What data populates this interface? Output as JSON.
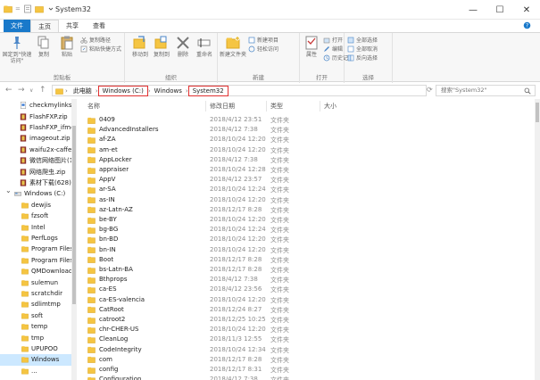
{
  "window": {
    "title": "System32",
    "qa_separator": "=",
    "controls": [
      "—",
      "☐",
      "✕"
    ]
  },
  "tabs": [
    {
      "label": "文件",
      "kind": "file"
    },
    {
      "label": "主页",
      "kind": "active"
    },
    {
      "label": "共享",
      "kind": "normal"
    },
    {
      "label": "查看",
      "kind": "normal"
    }
  ],
  "ribbon": {
    "clipboard": {
      "name": "剪贴板",
      "pin_label": "固定到\"快速访问\"",
      "copy_label": "复制",
      "paste_label": "粘贴",
      "cut_label": "剪切",
      "copy_path_label": "复制路径",
      "paste_shortcut_label": "粘贴快捷方式"
    },
    "organize": {
      "name": "组织",
      "move_label": "移动到",
      "copy_to_label": "复制到",
      "delete_label": "删除",
      "rename_label": "重命名"
    },
    "new": {
      "name": "新建",
      "folder_label": "新建文件夹",
      "item_label": "新建项目",
      "easy_access_label": "轻松访问"
    },
    "open": {
      "name": "打开",
      "props_label": "属性",
      "open_label": "打开",
      "edit_label": "编辑",
      "history_label": "历史记录"
    },
    "select": {
      "name": "选择",
      "all_label": "全部选择",
      "none_label": "全部取消",
      "invert_label": "反向选择"
    }
  },
  "address": {
    "crumbs": [
      "此电脑",
      "Windows (C:)",
      "Windows",
      "System32"
    ],
    "search_placeholder": "搜索\"System32\""
  },
  "columns": {
    "name": "名称",
    "date": "修改日期",
    "type": "类型",
    "size": "大小"
  },
  "nav_items": [
    {
      "label": "checkmylinks",
      "icon": "file"
    },
    {
      "label": "FlashFXP.zip",
      "icon": "zip"
    },
    {
      "label": "FlashFXP_ifmc",
      "icon": "zip"
    },
    {
      "label": "imageout.zip",
      "icon": "zip"
    },
    {
      "label": "waifu2x-caffe",
      "icon": "zip"
    },
    {
      "label": "微信网络图片(1).",
      "icon": "zip"
    },
    {
      "label": "网络爬虫.zip",
      "icon": "zip"
    },
    {
      "label": "素材下载(628)",
      "icon": "zip"
    },
    {
      "label": "Windows (C:)",
      "icon": "drive"
    },
    {
      "label": "dewjis",
      "icon": "folder"
    },
    {
      "label": "fzsoft",
      "icon": "folder"
    },
    {
      "label": "Intel",
      "icon": "folder"
    },
    {
      "label": "PerfLogs",
      "icon": "folder"
    },
    {
      "label": "Program Files",
      "icon": "folder"
    },
    {
      "label": "Program Files",
      "icon": "folder"
    },
    {
      "label": "QMDownload",
      "icon": "folder"
    },
    {
      "label": "sulemun",
      "icon": "folder"
    },
    {
      "label": "scratchdir",
      "icon": "folder"
    },
    {
      "label": "sdlimtmp",
      "icon": "folder"
    },
    {
      "label": "soft",
      "icon": "folder"
    },
    {
      "label": "temp",
      "icon": "folder"
    },
    {
      "label": "tmp",
      "icon": "folder"
    },
    {
      "label": "UPUPOO",
      "icon": "folder"
    },
    {
      "label": "Windows",
      "icon": "folder"
    },
    {
      "label": "...",
      "icon": "folder"
    }
  ],
  "files": [
    {
      "name": "0409",
      "date": "2018/4/12 23:51",
      "type": "文件夹"
    },
    {
      "name": "AdvancedInstallers",
      "date": "2018/4/12 7:38",
      "type": "文件夹"
    },
    {
      "name": "af-ZA",
      "date": "2018/10/24 12:20",
      "type": "文件夹"
    },
    {
      "name": "am-et",
      "date": "2018/10/24 12:20",
      "type": "文件夹"
    },
    {
      "name": "AppLocker",
      "date": "2018/4/12 7:38",
      "type": "文件夹"
    },
    {
      "name": "appraiser",
      "date": "2018/10/24 12:28",
      "type": "文件夹"
    },
    {
      "name": "AppV",
      "date": "2018/4/12 23:57",
      "type": "文件夹"
    },
    {
      "name": "ar-SA",
      "date": "2018/10/24 12:24",
      "type": "文件夹"
    },
    {
      "name": "as-IN",
      "date": "2018/10/24 12:20",
      "type": "文件夹"
    },
    {
      "name": "az-Latn-AZ",
      "date": "2018/12/17 8:28",
      "type": "文件夹"
    },
    {
      "name": "be-BY",
      "date": "2018/10/24 12:20",
      "type": "文件夹"
    },
    {
      "name": "bg-BG",
      "date": "2018/10/24 12:24",
      "type": "文件夹"
    },
    {
      "name": "bn-BD",
      "date": "2018/10/24 12:20",
      "type": "文件夹"
    },
    {
      "name": "bn-IN",
      "date": "2018/10/24 12:20",
      "type": "文件夹"
    },
    {
      "name": "Boot",
      "date": "2018/12/17 8:28",
      "type": "文件夹"
    },
    {
      "name": "bs-Latn-BA",
      "date": "2018/12/17 8:28",
      "type": "文件夹"
    },
    {
      "name": "Bthprops",
      "date": "2018/4/12 7:38",
      "type": "文件夹"
    },
    {
      "name": "ca-ES",
      "date": "2018/4/12 23:56",
      "type": "文件夹"
    },
    {
      "name": "ca-ES-valencia",
      "date": "2018/10/24 12:20",
      "type": "文件夹"
    },
    {
      "name": "CatRoot",
      "date": "2018/12/24 8:27",
      "type": "文件夹"
    },
    {
      "name": "catroot2",
      "date": "2018/12/25 10:25",
      "type": "文件夹"
    },
    {
      "name": "chr-CHER-US",
      "date": "2018/10/24 12:20",
      "type": "文件夹"
    },
    {
      "name": "CleanLog",
      "date": "2018/11/3 12:55",
      "type": "文件夹"
    },
    {
      "name": "CodeIntegrity",
      "date": "2018/10/24 12:34",
      "type": "文件夹"
    },
    {
      "name": "com",
      "date": "2018/12/17 8:28",
      "type": "文件夹"
    },
    {
      "name": "config",
      "date": "2018/12/17 8:31",
      "type": "文件夹"
    },
    {
      "name": "Configuration",
      "date": "2018/4/12 7:38",
      "type": "文件夹"
    }
  ],
  "colors": {
    "folder": "#f5c542",
    "folder_dark": "#dca826",
    "accent": "#1979ca",
    "highlight": "#e03030",
    "selection": "#cce8ff"
  }
}
